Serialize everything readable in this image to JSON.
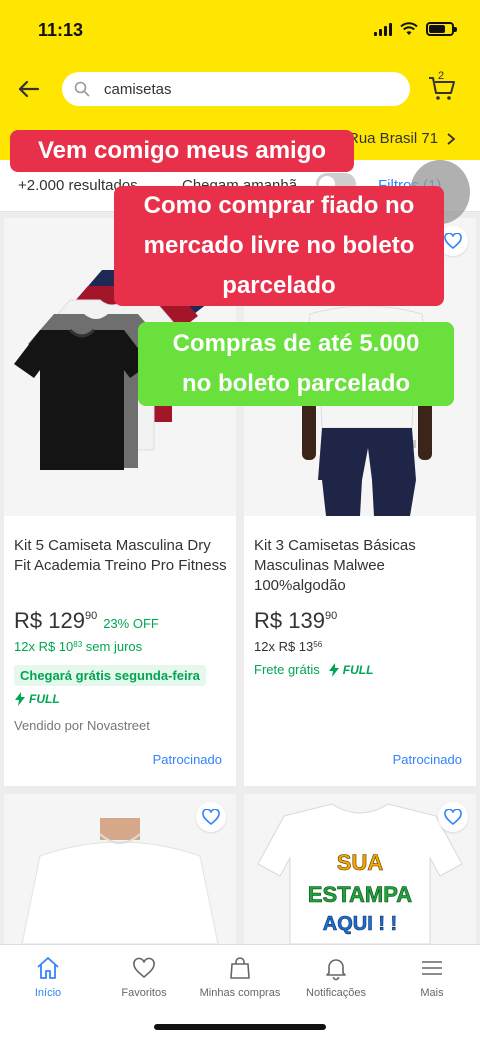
{
  "status_bar": {
    "time": "11:13"
  },
  "header": {
    "search_value": "camisetas",
    "cart_count": "2",
    "address": "Rua Brasil 71"
  },
  "filter_bar": {
    "results": "+2.000 resultados",
    "arrive_label": "Chegam amanhã",
    "filters_label": "Filtros (1)"
  },
  "overlays": {
    "line1": "Vem comigo meus amigo",
    "line2a": "Como comprar fiado no",
    "line2b": "mercado livre no boleto",
    "line2c": "parcelado",
    "line3a": "Compras de até 5.000",
    "line3b": "no boleto parcelado"
  },
  "products": [
    {
      "title": "Kit 5 Camiseta Masculina Dry Fit Academia Treino Pro Fitness",
      "price_int": "R$ 129",
      "price_cents": "90",
      "discount": "23% OFF",
      "installments_prefix": "12x R$ 10",
      "installments_cents": "83",
      "installments_suffix": "sem juros",
      "shipping": "Chegará grátis segunda-feira",
      "full_label": "FULL",
      "seller": "Vendido por Novastreet",
      "sponsored": "Patrocinado"
    },
    {
      "title": "Kit 3 Camisetas Básicas Masculinas Malwee 100%algodão",
      "price_int": "R$ 139",
      "price_cents": "90",
      "installments_prefix": "12x R$ 13",
      "installments_cents": "56",
      "shipping": "Frete grátis",
      "full_label": "FULL",
      "sponsored": "Patrocinado"
    },
    {
      "shirt_color": "white"
    },
    {
      "print_lines": [
        "SUA",
        "ESTAMPA",
        "AQUI ! !"
      ]
    }
  ],
  "tab_bar": {
    "items": [
      {
        "label": "Início",
        "icon": "home-icon",
        "active": true
      },
      {
        "label": "Favoritos",
        "icon": "heart-icon"
      },
      {
        "label": "Minhas compras",
        "icon": "bag-icon"
      },
      {
        "label": "Notificações",
        "icon": "bell-icon"
      },
      {
        "label": "Mais",
        "icon": "menu-icon"
      }
    ]
  },
  "colors": {
    "brand_yellow": "#ffe600",
    "link_blue": "#3483fa",
    "green": "#00a650",
    "overlay_red": "#e8304a",
    "overlay_green": "#69e03c"
  }
}
